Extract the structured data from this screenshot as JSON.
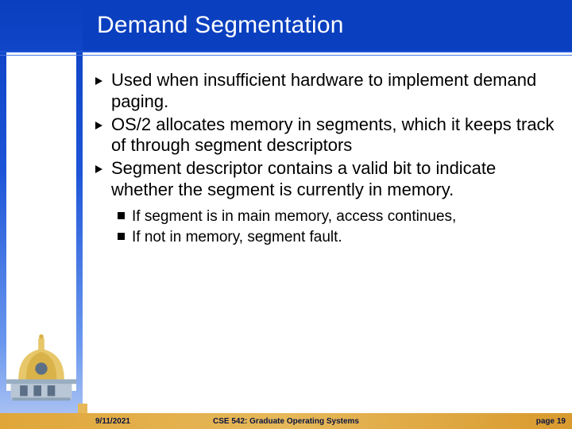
{
  "title": "Demand Segmentation",
  "bullets": {
    "b0": "Used when insufficient hardware to implement demand paging.",
    "b1": "OS/2 allocates memory in segments, which it keeps track of through segment descriptors",
    "b2": "Segment descriptor contains a valid bit to indicate whether the segment is currently in memory."
  },
  "subbullets": {
    "s0": "If segment is in main memory, access continues,",
    "s1": "If not in memory, segment fault."
  },
  "footer": {
    "date": "9/11/2021",
    "course": "CSE 542: Graduate Operating Systems",
    "page_label": "page ",
    "page_num": "19"
  }
}
